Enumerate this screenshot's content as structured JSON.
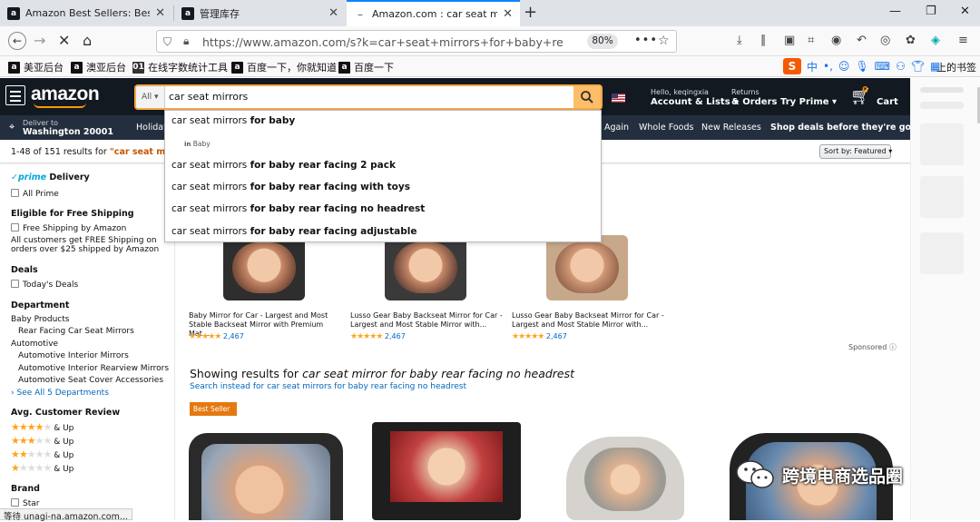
{
  "browser": {
    "tabs": [
      {
        "title": "Amazon Best Sellers: Best Ca",
        "favicon_color": "#f5a623"
      },
      {
        "title": "管理库存",
        "favicon_color": "#f5a623"
      },
      {
        "title": "Amazon.com : car seat mirro",
        "favicon_color": "#f5a623"
      }
    ],
    "url": "https://www.amazon.com/s?k=car+seat+mirrors+for+baby+rear+facing",
    "zoom": "80%",
    "bookmarks": [
      "美亚后台",
      "澳亚后台",
      "在线字数统计工具",
      "百度一下，你就知道",
      "百度一下"
    ],
    "bookmarks_more": "上的书签",
    "sogou_text": "中",
    "status_text": "等待 unagi-na.amazon.com..."
  },
  "amazon": {
    "logo": "amazon",
    "search": {
      "category": "All",
      "query": "car seat mirrors"
    },
    "header": {
      "account_line1": "Hello, keqingxia",
      "account_line2": "Account & Lists",
      "returns_line1": "Returns",
      "returns_line2": "& Orders",
      "prime_label": "Try Prime",
      "cart_label": "Cart",
      "cart_count": "0"
    },
    "nav": {
      "deliver_line1": "Deliver to",
      "deliver_line2": "Washington 20001",
      "links": [
        "Holiday",
        "Again",
        "Whole Foods",
        "New Releases",
        "Shop deals before they're gone"
      ]
    },
    "results": {
      "count_text": "1-48 of 151 results for",
      "query_text": "\"car seat mirror",
      "sort_label": "Sort by: Featured"
    },
    "suggestions": [
      {
        "normal": "car seat mirrors ",
        "bold": "for baby"
      },
      {
        "normal": "car seat mirrors ",
        "bold": "for baby rear facing 2 pack"
      },
      {
        "normal": "car seat mirrors ",
        "bold": "for baby rear facing with toys"
      },
      {
        "normal": "car seat mirrors ",
        "bold": "for baby rear facing no headrest"
      },
      {
        "normal": "car seat mirrors ",
        "bold": "for baby rear facing adjustable"
      }
    ],
    "suggestion_sub": {
      "prefix": "in",
      "text": "Baby"
    },
    "sidebar": {
      "prime_word": "prime",
      "prime_rest": "Delivery",
      "all_prime": "All Prime",
      "free_ship_heading": "Eligible for Free Shipping",
      "free_ship_option": "Free Shipping by Amazon",
      "free_ship_note1": "All customers get FREE Shipping on",
      "free_ship_note2": "orders over $25 shipped by Amazon",
      "deals_heading": "Deals",
      "todays_deals": "Today's Deals",
      "department_heading": "Department",
      "dept_items": [
        "Baby Products",
        "Rear Facing Car Seat Mirrors",
        "Automotive",
        "Automotive Interior Mirrors",
        "Automotive Interior Rearview Mirrors",
        "Automotive Seat Cover Accessories"
      ],
      "see_all": "See All 5 Departments",
      "review_heading": "Avg. Customer Review",
      "and_up": "& Up",
      "brand_heading": "Brand",
      "brand_first": "Star"
    },
    "sponsored_products": [
      {
        "title1": "Baby Mirror for Car - Largest and Most",
        "title2": "Stable Backseat Mirror with Premium Mat...",
        "rating_count": "2,467"
      },
      {
        "title1": "Lusso Gear Baby Backseat Mirror for Car -",
        "title2": "Largest and Most Stable Mirror with...",
        "rating_count": "2,467"
      },
      {
        "title1": "Lusso Gear Baby Backseat Mirror for Car -",
        "title2": "Largest and Most Stable Mirror with...",
        "rating_count": "2,467"
      }
    ],
    "sponsored_label": "Sponsored",
    "showing_prefix": "Showing results for",
    "showing_query": "car seat mirror for baby rear facing no headrest",
    "search_instead": "Search instead for car seat mirrors for baby rear facing no headrest",
    "best_seller_badge": "Best Seller"
  },
  "watermark": "跨境电商选品圈",
  "colors": {
    "amazon_dark": "#131921",
    "amazon_nav": "#232f3e",
    "amazon_orange": "#ff9900",
    "search_button": "#febd69",
    "link_blue": "#0066c0",
    "star_orange": "#ffa41c"
  }
}
